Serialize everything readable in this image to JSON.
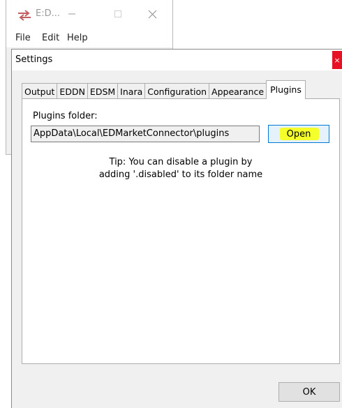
{
  "main_window": {
    "title": "E:D...",
    "menu": [
      "File",
      "Edit",
      "Help"
    ]
  },
  "settings": {
    "title": "Settings",
    "close_glyph": "×",
    "tabs": [
      "Output",
      "EDDN",
      "EDSM",
      "Inara",
      "Configuration",
      "Appearance",
      "Plugins"
    ],
    "active_tab": "Plugins",
    "plugins_folder_label": "Plugins folder:",
    "plugins_folder_path": "AppData\\Local\\EDMarketConnector\\plugins",
    "open_label": "Open",
    "tip_line1": "Tip: You can disable a plugin by",
    "tip_line2": "adding '.disabled' to its folder name",
    "ok_label": "OK"
  },
  "colors": {
    "highlight": "#f5ff2a",
    "open_border": "#0078d7",
    "close_red": "#e81123"
  },
  "icons": {
    "app": "app-icon",
    "minimize": "minimize-icon",
    "maximize": "maximize-icon",
    "close": "close-icon"
  }
}
